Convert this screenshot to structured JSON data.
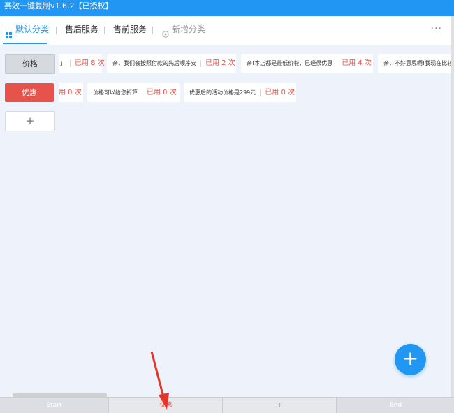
{
  "window": {
    "title": "赛效一键复制v1.6.2【已授权】"
  },
  "tabs": [
    {
      "label": "默认分类"
    },
    {
      "label": "售后服务"
    },
    {
      "label": "售前服务"
    },
    {
      "label": "新增分类"
    }
  ],
  "more_label": "···",
  "categories": [
    {
      "label": "价格"
    },
    {
      "label": "优惠"
    },
    {
      "label": "+"
    }
  ],
  "row1": [
    {
      "text": "」",
      "used": "已用 8 次"
    },
    {
      "text": "亲，我们会按照付款的先后顺序安",
      "used": "已用 2 次"
    },
    {
      "text": "亲!本店都是最低价啦，已经很优惠",
      "used": "已用 4 次"
    },
    {
      "text": "亲，不好意思啊!我现在比较",
      "used": ""
    }
  ],
  "row2": [
    {
      "text": "",
      "used": "用 0 次"
    },
    {
      "text": "价格可以给您折算",
      "used": "已用 0 次"
    },
    {
      "text": "优惠后的活动价格是299元",
      "used": "已用 0 次"
    }
  ],
  "fab_label": "+",
  "bottom": {
    "start": "Start",
    "current": "优惠",
    "add": "+",
    "end": "End"
  },
  "colors": {
    "accent": "#2196f3",
    "danger": "#e5534b"
  }
}
